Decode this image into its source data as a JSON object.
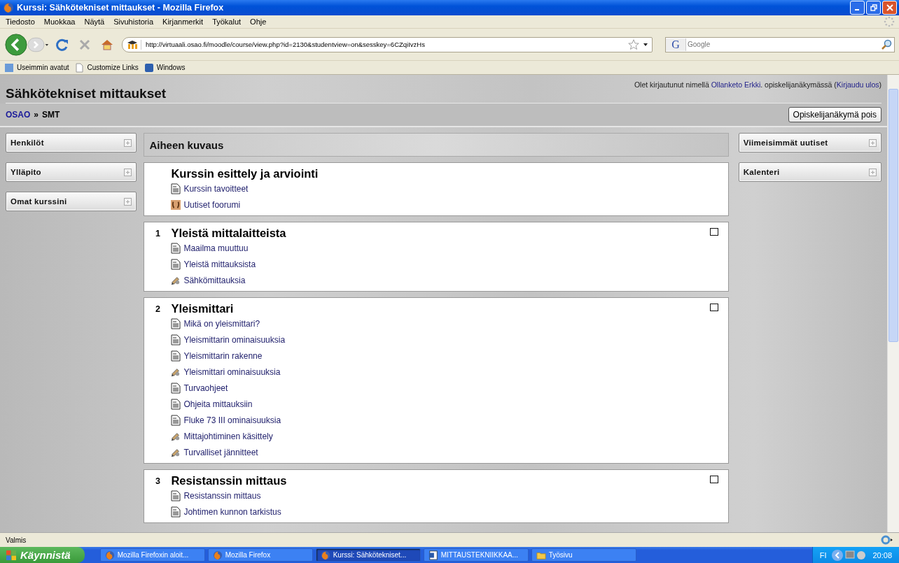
{
  "window": {
    "title": "Kurssi: Sähkötekniset mittaukset - Mozilla Firefox"
  },
  "menu": [
    "Tiedosto",
    "Muokkaa",
    "Näytä",
    "Sivuhistoria",
    "Kirjanmerkit",
    "Työkalut",
    "Ohje"
  ],
  "address_bar": {
    "url": "http://virtuaali.osao.fi/moodle/course/view.php?id=2130&studentview=on&sesskey=6CZqiIvzHs"
  },
  "search": {
    "engine_icon": "G",
    "placeholder": "Google"
  },
  "bookmarks": [
    "Useimmin avatut",
    "Customize Links",
    "Windows"
  ],
  "page": {
    "course_title": "Sähkötekniset mittaukset",
    "login_info": {
      "prefix": "Olet kirjautunut nimellä",
      "user": "Ollanketo Erkki",
      "middle": ". opiskelijanäkymässä (",
      "logout": "Kirjaudu ulos",
      "suffix": ")"
    },
    "breadcrumb": [
      {
        "label": "OSAO",
        "link": true
      },
      {
        "label": "»",
        "link": false
      },
      {
        "label": "SMT",
        "link": false
      }
    ],
    "student_view_button": "Opiskelijanäkymä pois",
    "left_blocks": [
      "Henkilöt",
      "Ylläpito",
      "Omat kurssini"
    ],
    "right_blocks": [
      "Viimeisimmät uutiset",
      "Kalenteri"
    ],
    "topic_header": "Aiheen kuvaus",
    "sections": [
      {
        "title": "Kurssin esittely ja arviointi",
        "activities": [
          {
            "kind": "page",
            "label": "Kurssin tavoitteet"
          },
          {
            "kind": "forum",
            "label": "Uutiset foorumi"
          }
        ]
      },
      {
        "number": "1",
        "title": "Yleistä mittalaitteista",
        "activities": [
          {
            "kind": "page",
            "label": "Maailma muuttuu"
          },
          {
            "kind": "page",
            "label": "Yleistä mittauksista"
          },
          {
            "kind": "lesson",
            "label": "Sähkömittauksia"
          }
        ]
      },
      {
        "number": "2",
        "title": "Yleismittari",
        "activities": [
          {
            "kind": "page",
            "label": "Mikä on yleismittari?"
          },
          {
            "kind": "page",
            "label": "Yleismittarin ominaisuuksia"
          },
          {
            "kind": "page",
            "label": "Yleismittarin rakenne"
          },
          {
            "kind": "lesson",
            "label": "Yleismittari ominaisuuksia"
          },
          {
            "kind": "page",
            "label": "Turvaohjeet"
          },
          {
            "kind": "page",
            "label": "Ohjeita mittauksiin"
          },
          {
            "kind": "page",
            "label": "Fluke 73 III ominaisuuksia"
          },
          {
            "kind": "lesson",
            "label": "Mittajohtiminen käsittely"
          },
          {
            "kind": "lesson",
            "label": "Turvalliset jännitteet"
          }
        ]
      },
      {
        "number": "3",
        "title": "Resistanssin mittaus",
        "activities": [
          {
            "kind": "page",
            "label": "Resistanssin mittaus"
          },
          {
            "kind": "page",
            "label": "Johtimen kunnon tarkistus"
          }
        ]
      }
    ]
  },
  "status_bar": {
    "text": "Valmis"
  },
  "taskbar": {
    "start": "Käynnistä",
    "tasks": [
      {
        "kind": "browser",
        "label": "Mozilla Firefoxin aloit...",
        "selected": false
      },
      {
        "kind": "browser",
        "label": "Mozilla Firefox",
        "selected": false
      },
      {
        "kind": "browser",
        "label": "Kurssi: Sähkötekniset...",
        "selected": true
      },
      {
        "kind": "document",
        "label": "MITTAUSTEKNIIKKAA...",
        "selected": false
      },
      {
        "kind": "folder",
        "label": "Työsivu",
        "selected": false
      }
    ],
    "language": "FI",
    "clock": "20:08"
  }
}
